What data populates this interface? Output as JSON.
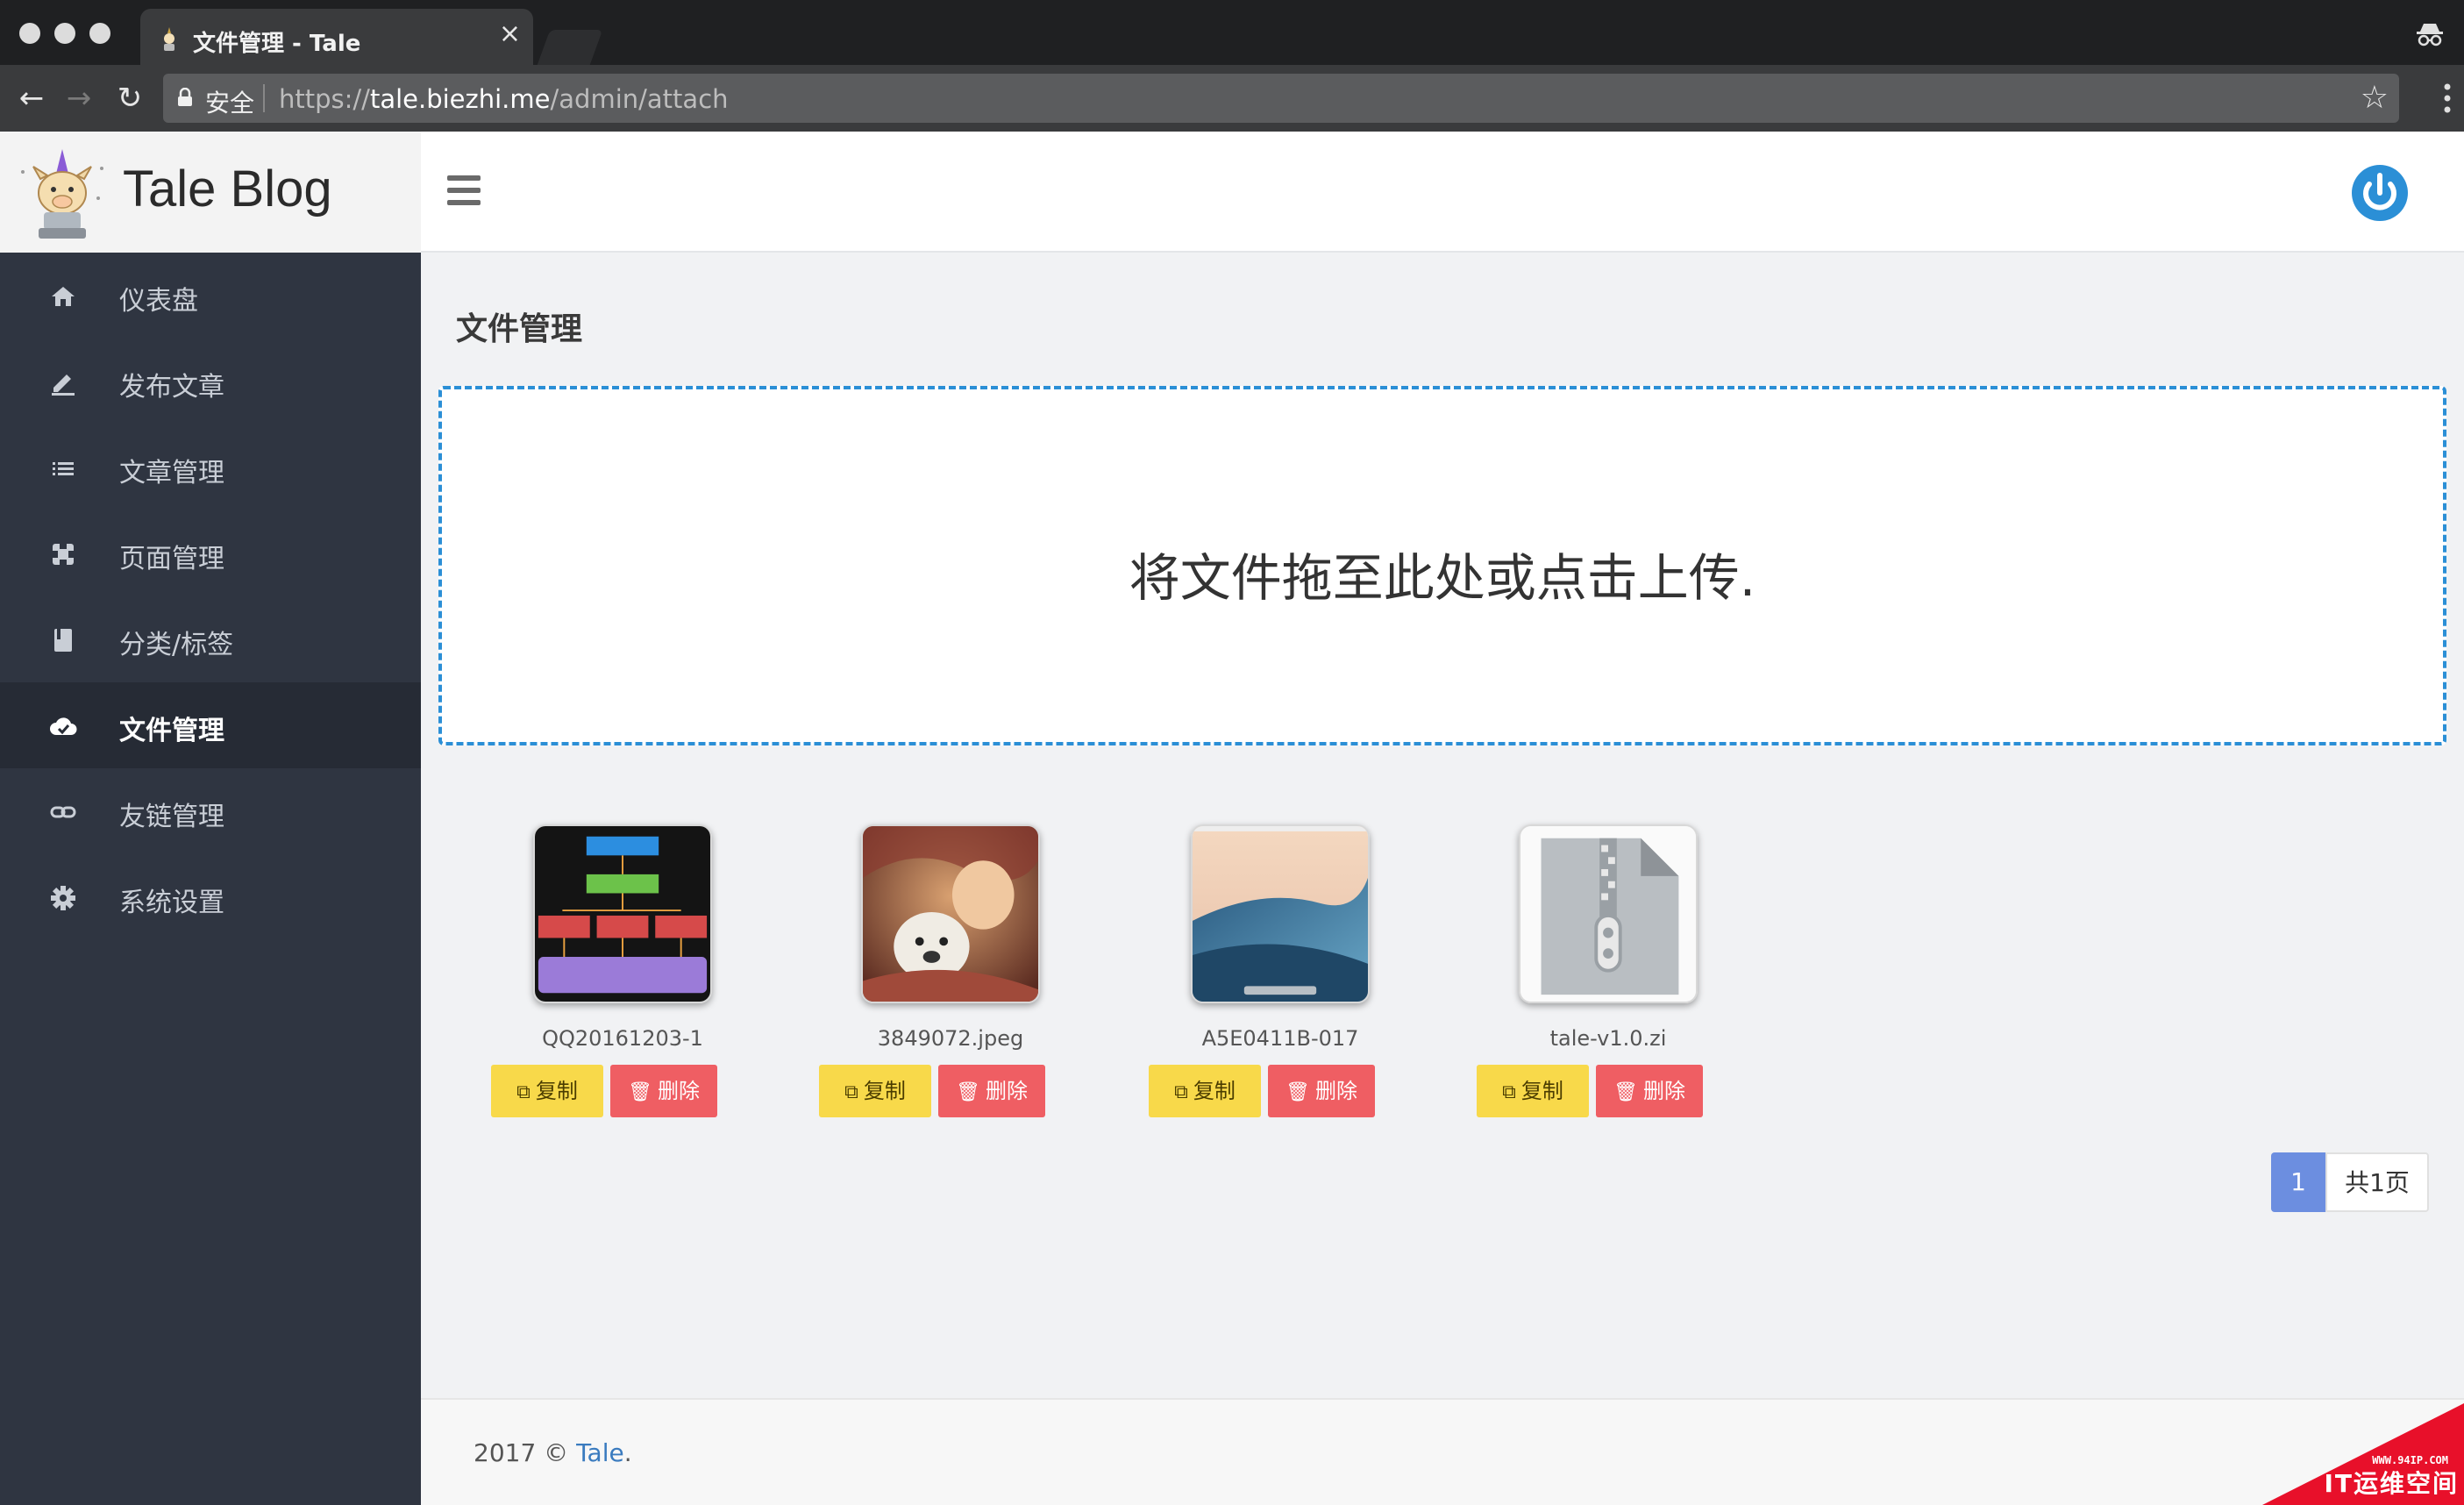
{
  "browser": {
    "tab_title": "文件管理 - Tale",
    "tab_close": "×",
    "secure_label": "安全",
    "url_scheme": "https://",
    "url_host": "tale.biezhi.me",
    "url_path": "/admin/attach",
    "back": "←",
    "forward": "→",
    "reload": "↻",
    "star": "☆"
  },
  "header": {
    "brand": "Tale Blog"
  },
  "sidebar": {
    "items": [
      {
        "label": "仪表盘",
        "icon": "home-icon"
      },
      {
        "label": "发布文章",
        "icon": "pencil-icon"
      },
      {
        "label": "文章管理",
        "icon": "list-icon"
      },
      {
        "label": "页面管理",
        "icon": "pages-icon"
      },
      {
        "label": "分类/标签",
        "icon": "book-icon"
      },
      {
        "label": "文件管理",
        "icon": "cloud-upload-icon",
        "active": true
      },
      {
        "label": "友链管理",
        "icon": "link-icon"
      },
      {
        "label": "系统设置",
        "icon": "gear-icon"
      }
    ]
  },
  "main": {
    "title": "文件管理",
    "dropzone_text": "将文件拖至此处或点击上传.",
    "files": [
      {
        "name": "QQ20161203-1",
        "thumb": "architecture-diagram"
      },
      {
        "name": "3849072.jpeg",
        "thumb": "child-with-dog-photo"
      },
      {
        "name": "A5E0411B-017",
        "thumb": "desktop-wave-screenshot"
      },
      {
        "name": "tale-v1.0.zi",
        "thumb": "zip-archive-icon"
      }
    ],
    "copy_label": "复制",
    "delete_label": "删除",
    "pagination": {
      "current": "1",
      "total": "共1页"
    }
  },
  "footer": {
    "year": "2017 © ",
    "link": "Tale",
    "period": "."
  },
  "watermark": {
    "site": "WWW.94IP.COM",
    "text": "IT运维空间"
  },
  "colors": {
    "sidebar_bg": "#2f3541",
    "accent_blue": "#2b8fd6",
    "copy_yellow": "#f8d94a",
    "delete_red": "#ef5e63",
    "pager_blue": "#6c8ee0"
  }
}
